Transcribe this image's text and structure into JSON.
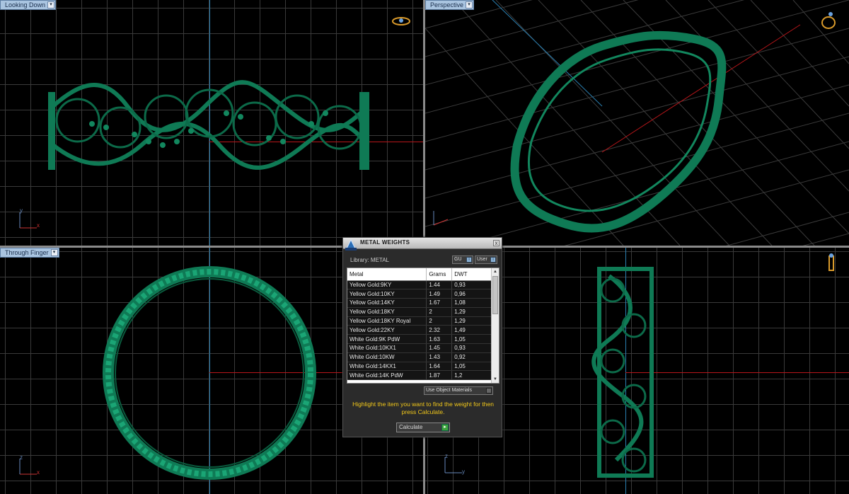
{
  "viewports": {
    "top_left": {
      "label": "Looking Down"
    },
    "top_right": {
      "label": "Perspective"
    },
    "bottom_left": {
      "label": "Through Finger"
    }
  },
  "colors": {
    "ring": "#0f7a55",
    "axis_x": "#b8161a",
    "axis_y": "#2a7fb0",
    "hint": "#f2c81a"
  },
  "axes": {
    "x": "x",
    "y": "y",
    "z": "z"
  },
  "dialog": {
    "title": "METAL WEIGHTS",
    "close": "x",
    "library_label": "Library: METAL",
    "gu_label": "GU",
    "user_label": "User",
    "columns": [
      "Metal",
      "Grams",
      "DWT"
    ],
    "rows": [
      [
        "Yellow Gold:9KY",
        "1.44",
        "0,93"
      ],
      [
        "Yellow Gold:10KY",
        "1.49",
        "0,96"
      ],
      [
        "Yellow Gold:14KY",
        "1.67",
        "1,08"
      ],
      [
        "Yellow Gold:18KY",
        "2",
        "1,29"
      ],
      [
        "Yellow Gold:18KY Royal",
        "2",
        "1,29"
      ],
      [
        "Yellow Gold:22KY",
        "2.32",
        "1,49"
      ],
      [
        "White Gold:9K PdW",
        "1.63",
        "1,05"
      ],
      [
        "White Gold:10KX1",
        "1.45",
        "0,93"
      ],
      [
        "White Gold:10KW",
        "1.43",
        "0,92"
      ],
      [
        "White Gold:14KX1",
        "1.64",
        "1,05"
      ],
      [
        "White Gold:14K PdW",
        "1.87",
        "1,2"
      ]
    ],
    "use_object_materials": "Use Object Materials",
    "hint": "Highlight the item you want to find the weight for then press Calculate.",
    "calculate_label": "Calculate"
  }
}
